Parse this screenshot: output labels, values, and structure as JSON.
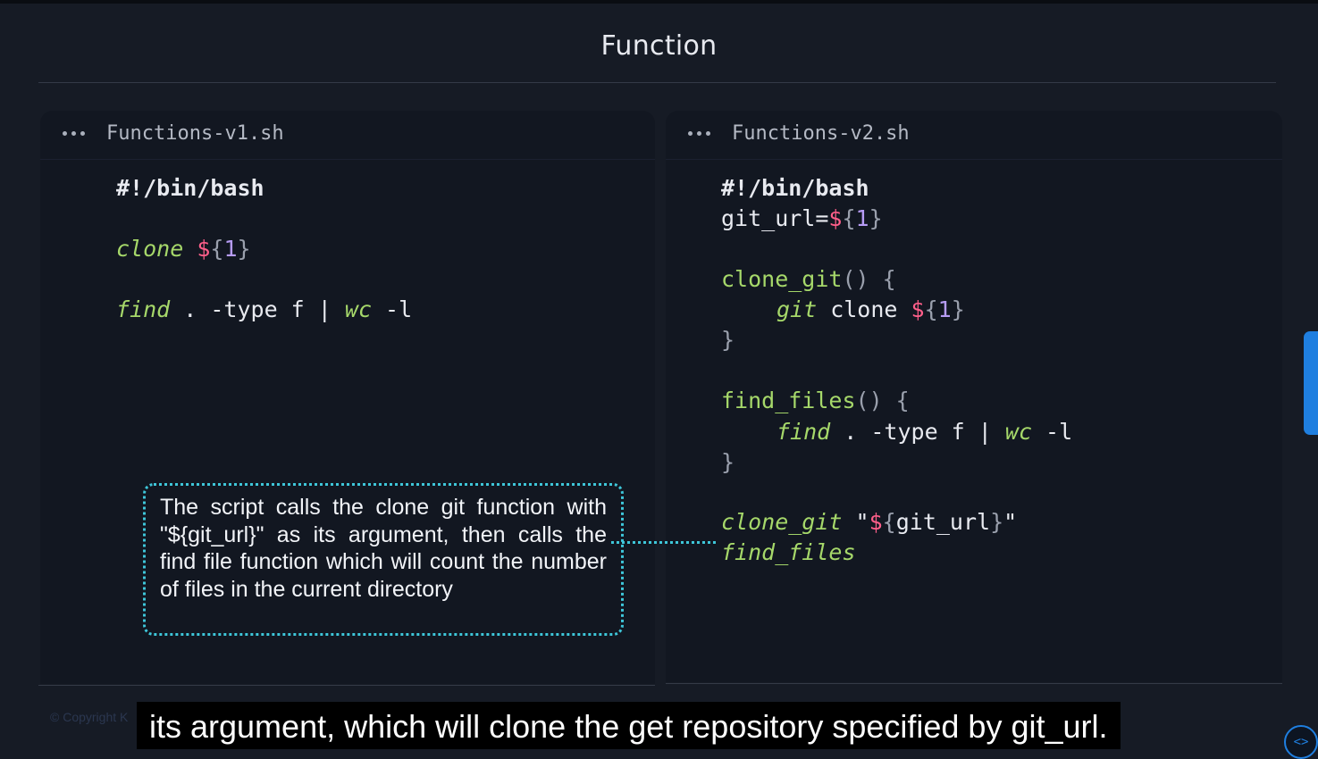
{
  "slide": {
    "title": "Function"
  },
  "panels": [
    {
      "filename": "Functions-v1.sh"
    },
    {
      "filename": "Functions-v2.sh"
    }
  ],
  "code_v1": {
    "shebang": "#!/bin/bash",
    "clone_cmd": "clone",
    "find_cmd": "find",
    "find_args": " . -type f | ",
    "wc_cmd": "wc",
    "wc_args": " -l"
  },
  "code_v2": {
    "shebang": "#!/bin/bash",
    "var_assign": "git_url=",
    "clone_fn_name": "clone_git",
    "git_cmd": "git",
    "git_args": " clone ",
    "find_fn_name": "find_files",
    "find_cmd": "find",
    "find_args": " . -type f | ",
    "wc_cmd": "wc",
    "wc_args": " -l",
    "call_clone": "clone_git",
    "call_arg_var": "git_url",
    "call_find": "find_files"
  },
  "syntax": {
    "dollar": "$",
    "open": "{",
    "one": "1",
    "close": "}",
    "quote": "\"",
    "parens": "()",
    "open_brace": " {",
    "close_brace": "}"
  },
  "callout": {
    "text": "The script calls the clone git function with \"${git_url}\" as its argument, then calls the find file function which will count the number of files in the current directory"
  },
  "footer": {
    "copyright": "© Copyright K"
  },
  "subtitle": {
    "text": "its argument, which will clone the get repository specified by git_url."
  },
  "colors": {
    "accent": "#3ec6d9",
    "function": "#a6d86a",
    "dollar": "#ff5f8a",
    "number": "#b79cf5",
    "background": "#161b25"
  },
  "icons": {
    "side_tab": "feedback-tab-icon",
    "code_button": "code-brackets-icon"
  }
}
